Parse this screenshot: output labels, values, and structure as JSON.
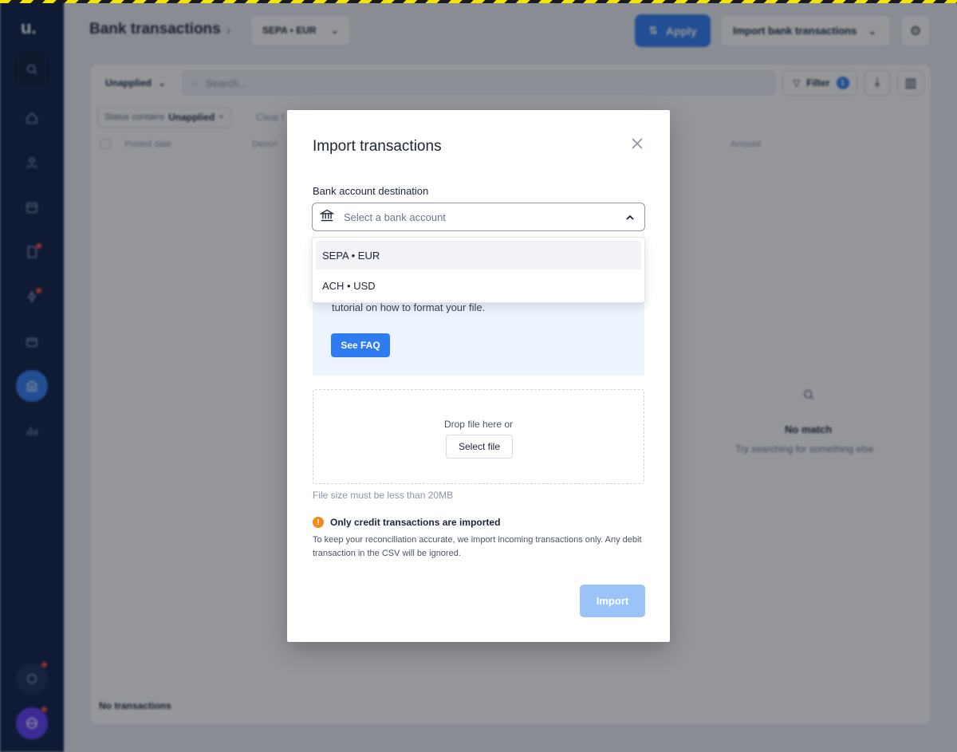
{
  "background": {
    "page_title": "Bank transactions",
    "account_selector": "SEPA • EUR",
    "apply_label": "Apply",
    "import_bank_label": "Import bank transactions",
    "status_filter": "Unapplied",
    "search_placeholder": "Search...",
    "filter_label": "Filter",
    "filter_count": "1",
    "chip_prefix": "Status contains",
    "chip_value": "Unapplied",
    "clear_label": "Clear f",
    "columns": [
      "Posted date",
      "Descri",
      "Amount"
    ],
    "empty_title": "No match",
    "empty_subtitle": "Try searching for something else",
    "footer": "No transactions"
  },
  "modal": {
    "title": "Import transactions",
    "destination_label": "Bank account destination",
    "select_placeholder": "Select a bank account",
    "options": [
      "SEPA • EUR",
      "ACH • USD"
    ],
    "info_text": "tutorial on how to format your file.",
    "faq_label": "See FAQ",
    "drop_text": "Drop file here or",
    "select_file_label": "Select file",
    "size_note": "File size must be less than 20MB",
    "warning_title": "Only credit transactions are imported",
    "warning_body": "To keep your reconciliation accurate, we import incoming transactions only. Any debit transaction in the CSV will be ignored.",
    "import_label": "Import"
  },
  "colors": {
    "sidebar": "#0b1e45",
    "accent": "#2f7bf0",
    "warning": "#f28a1c",
    "disabled_button": "#9cc3f8"
  }
}
